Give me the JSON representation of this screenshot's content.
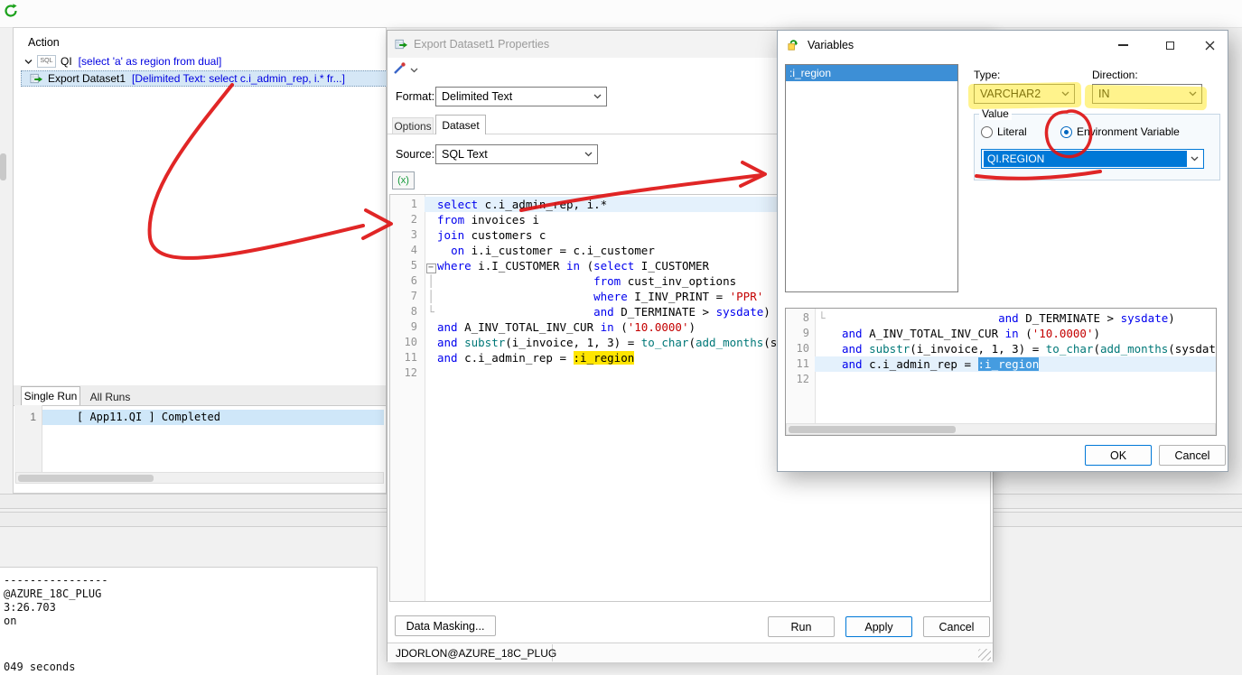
{
  "colors": {
    "accent_blue": "#0078d7",
    "selection_blue": "#3d8fd6",
    "current_line": "#e4f1fc",
    "sql_keyword": "#0000ee",
    "sql_string": "#c40000",
    "sql_function": "#007878",
    "bind_var_highlight": "#ffe500",
    "annotation_red": "#de1414",
    "highlighter_yellow": "#ffe81a"
  },
  "action_panel": {
    "title": "Action",
    "sql_badge": "SQL",
    "node_qi": {
      "label": "QI",
      "detail": "[select 'a' as region  from dual]"
    },
    "node_export": {
      "label": "Export Dataset1",
      "detail": "[Delimited Text: select c.i_admin_rep, i.* fr...]"
    },
    "tab_single_run": "Single Run",
    "tab_all_runs": "All Runs",
    "run_row": {
      "num": "1",
      "text": "[ App11.QI ] Completed"
    },
    "log_line1": "----------------",
    "log_line2": "@AZURE_18C_PLUG",
    "log_line3": "3:26.703",
    "log_line4": "on",
    "runtime_line": "049 seconds"
  },
  "properties_dialog": {
    "title": "Export Dataset1 Properties",
    "format_label": "Format:",
    "format_value": "Delimited Text",
    "tab_options": "Options",
    "tab_dataset": "Dataset",
    "source_label": "Source:",
    "source_value": "SQL Text",
    "vars_button": "(x)",
    "data_masking_button": "Data Masking...",
    "run_button": "Run",
    "apply_button": "Apply",
    "cancel_button": "Cancel",
    "status": "JDORLON@AZURE_18C_PLUG"
  },
  "variables_dialog": {
    "title": "Variables",
    "variable_item": ":i_region",
    "type_label": "Type:",
    "type_value": "VARCHAR2",
    "direction_label": "Direction:",
    "direction_value": "IN",
    "value_group_label": "Value",
    "literal_radio_label": "Literal",
    "env_radio_label": "Environment Variable",
    "env_value": "QI.REGION",
    "ok_button": "OK",
    "cancel_button": "Cancel"
  },
  "code": {
    "main_editor": {
      "lines": [
        {
          "n": "1",
          "cur": true,
          "toks": [
            [
              "k",
              "select"
            ],
            [
              "i",
              " c.i_admin_rep, i.*"
            ]
          ]
        },
        {
          "n": "2",
          "toks": [
            [
              "k",
              "from"
            ],
            [
              "i",
              " invoices i"
            ]
          ]
        },
        {
          "n": "3",
          "toks": [
            [
              "k",
              "join"
            ],
            [
              "i",
              " customers c"
            ]
          ]
        },
        {
          "n": "4",
          "toks": [
            [
              "i",
              "  "
            ],
            [
              "k",
              "on"
            ],
            [
              "i",
              " i.i_customer = c.i_customer"
            ]
          ]
        },
        {
          "n": "5",
          "fold": "box",
          "toks": [
            [
              "k",
              "where"
            ],
            [
              "i",
              " i.I_CUSTOMER "
            ],
            [
              "k",
              "in"
            ],
            [
              "i",
              " ("
            ],
            [
              "k",
              "select"
            ],
            [
              "i",
              " I_CUSTOMER"
            ]
          ]
        },
        {
          "n": "6",
          "fold": "bar",
          "toks": [
            [
              "i",
              "                       "
            ],
            [
              "k",
              "from"
            ],
            [
              "i",
              " cust_inv_options"
            ]
          ]
        },
        {
          "n": "7",
          "fold": "bar",
          "toks": [
            [
              "i",
              "                       "
            ],
            [
              "k",
              "where"
            ],
            [
              "i",
              " I_INV_PRINT = "
            ],
            [
              "s",
              "'PPR'"
            ]
          ]
        },
        {
          "n": "8",
          "fold": "corner",
          "toks": [
            [
              "i",
              "                       "
            ],
            [
              "k",
              "and"
            ],
            [
              "i",
              " D_TERMINATE > "
            ],
            [
              "k",
              "sysdate"
            ],
            [
              "i",
              ")"
            ]
          ]
        },
        {
          "n": "9",
          "toks": [
            [
              "k",
              "and"
            ],
            [
              "i",
              " A_INV_TOTAL_INV_CUR "
            ],
            [
              "k",
              "in"
            ],
            [
              "i",
              " ("
            ],
            [
              "s",
              "'10.0000'"
            ],
            [
              "i",
              ")"
            ]
          ]
        },
        {
          "n": "10",
          "toks": [
            [
              "k",
              "and"
            ],
            [
              "i",
              " "
            ],
            [
              "f",
              "substr"
            ],
            [
              "i",
              "(i_invoice, 1, 3) = "
            ],
            [
              "f",
              "to_char"
            ],
            [
              "i",
              "("
            ],
            [
              "f",
              "add_months"
            ],
            [
              "i",
              "(s"
            ]
          ]
        },
        {
          "n": "11",
          "toks": [
            [
              "k",
              "and"
            ],
            [
              "i",
              " c.i_admin_rep = "
            ],
            [
              "vy",
              ":i_region"
            ]
          ]
        },
        {
          "n": "12",
          "toks": []
        }
      ]
    },
    "preview": {
      "lines": [
        {
          "n": "8",
          "fold": "corner",
          "toks": [
            [
              "i",
              "                       "
            ],
            [
              "k",
              "and"
            ],
            [
              "i",
              " D_TERMINATE > "
            ],
            [
              "k",
              "sysdate"
            ],
            [
              "i",
              ")"
            ]
          ]
        },
        {
          "n": "9",
          "toks": [
            [
              "k",
              "and"
            ],
            [
              "i",
              " A_INV_TOTAL_INV_CUR "
            ],
            [
              "k",
              "in"
            ],
            [
              "i",
              " ("
            ],
            [
              "s",
              "'10.0000'"
            ],
            [
              "i",
              ")"
            ]
          ]
        },
        {
          "n": "10",
          "toks": [
            [
              "k",
              "and"
            ],
            [
              "i",
              " "
            ],
            [
              "f",
              "substr"
            ],
            [
              "i",
              "(i_invoice, 1, 3) = "
            ],
            [
              "f",
              "to_char"
            ],
            [
              "i",
              "("
            ],
            [
              "f",
              "add_months"
            ],
            [
              "i",
              "(sysdat"
            ]
          ]
        },
        {
          "n": "11",
          "cur": true,
          "toks": [
            [
              "k",
              "and"
            ],
            [
              "i",
              " c.i_admin_rep = "
            ],
            [
              "vs",
              ":i_region"
            ]
          ]
        },
        {
          "n": "12",
          "toks": []
        }
      ]
    }
  }
}
